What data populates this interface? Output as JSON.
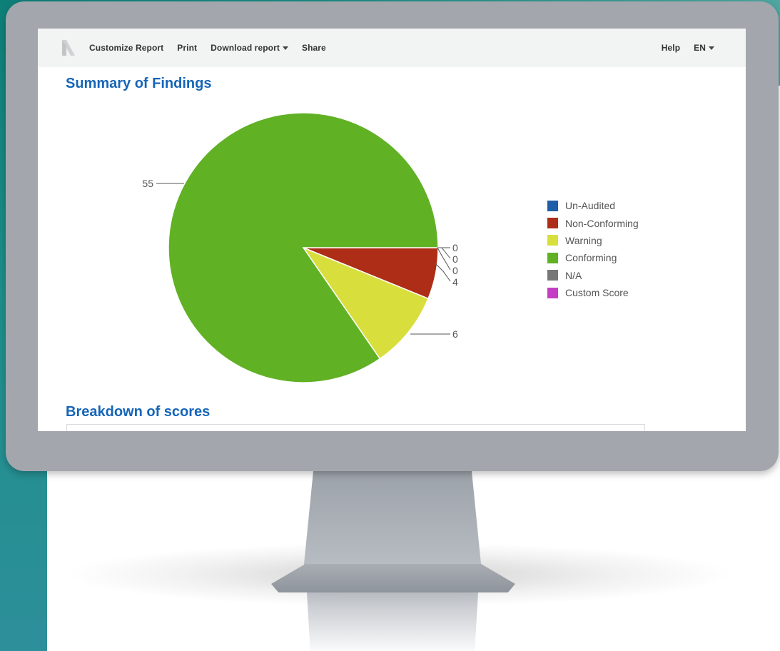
{
  "toolbar": {
    "items": [
      "Customize Report",
      "Print",
      "Download report",
      "Share"
    ],
    "help": "Help",
    "language": "EN"
  },
  "sections": {
    "summary_title": "Summary of Findings",
    "breakdown_title": "Breakdown of scores"
  },
  "chart_data": {
    "type": "pie",
    "categories": [
      "Un-Audited",
      "Non-Conforming",
      "Warning",
      "Conforming",
      "N/A",
      "Custom Score"
    ],
    "values": [
      0,
      4,
      6,
      55,
      0,
      0
    ],
    "colors": [
      "#1e5ea8",
      "#ad2d17",
      "#d8df3c",
      "#60b124",
      "#777777",
      "#c43ec4"
    ],
    "legend_position": "right",
    "data_labels": {
      "zero_values": [
        "0",
        "0",
        "0"
      ],
      "non_conforming": "4",
      "warning": "6",
      "conforming": "55"
    }
  }
}
